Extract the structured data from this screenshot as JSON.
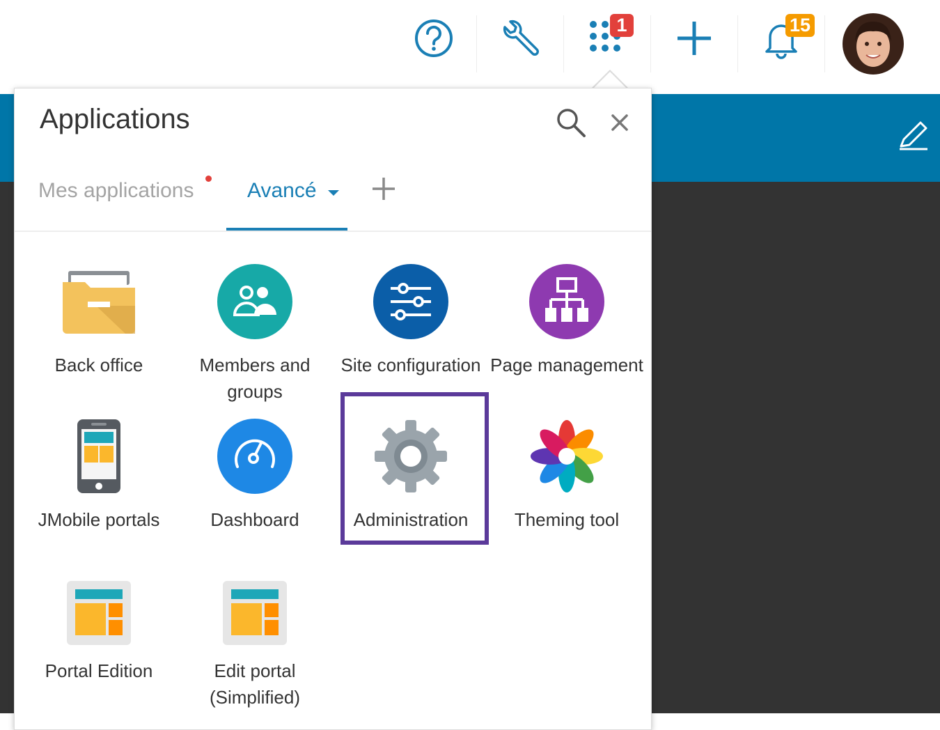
{
  "header": {
    "apps_badge": "1",
    "notifications_badge": "15",
    "colors": {
      "icon": "#1a7fb5",
      "apps_badge": "#e2403b",
      "notif_badge": "#f59b00"
    }
  },
  "page": {
    "band_color": "#0076a8",
    "dark_color": "#333333"
  },
  "popup": {
    "title": "Applications",
    "tabs": [
      {
        "label": "Mes applications",
        "has_dot": true
      },
      {
        "label": "Avancé",
        "active": true
      }
    ],
    "apps": [
      {
        "label": "Back office",
        "icon": "folder-icon"
      },
      {
        "label": "Members and groups",
        "icon": "members-icon"
      },
      {
        "label": "Site configuration",
        "icon": "sliders-icon"
      },
      {
        "label": "Page management",
        "icon": "sitemap-icon"
      },
      {
        "label": "JMobile portals",
        "icon": "mobile-icon"
      },
      {
        "label": "Dashboard",
        "icon": "speedometer-icon"
      },
      {
        "label": "Administration",
        "icon": "gear-icon",
        "highlighted": true
      },
      {
        "label": "Theming tool",
        "icon": "flower-icon"
      },
      {
        "label": "Portal Edition",
        "icon": "portal-layout-icon"
      },
      {
        "label": "Edit portal (Simplified)",
        "icon": "portal-layout-icon"
      }
    ]
  }
}
